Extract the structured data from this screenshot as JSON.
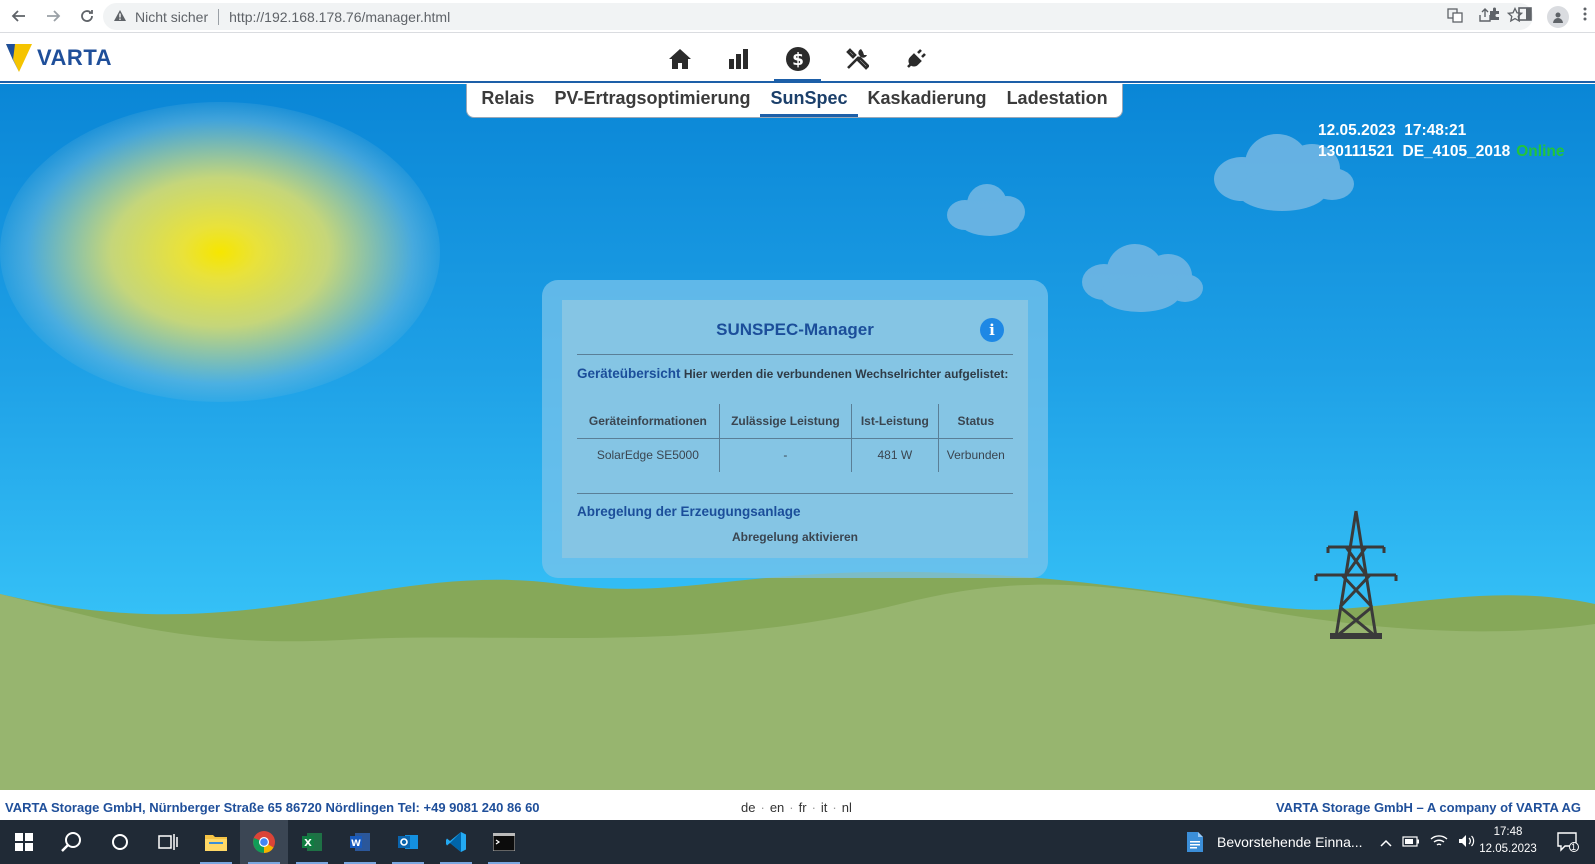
{
  "browser": {
    "security_label": "Nicht sicher",
    "url": "http://192.168.178.76/manager.html"
  },
  "app": {
    "logo_text": "VARTA",
    "top_nav": [
      {
        "icon": "home-icon"
      },
      {
        "icon": "bar-chart-icon"
      },
      {
        "icon": "dollar-icon",
        "active": true
      },
      {
        "icon": "tools-icon"
      },
      {
        "icon": "plug-icon"
      }
    ],
    "sub_nav": [
      "Relais",
      "PV-Ertragsoptimierung",
      "SunSpec",
      "Kaskadierung",
      "Ladestation"
    ],
    "sub_nav_active": "SunSpec"
  },
  "status": {
    "date": "12.05.2023",
    "time": "17:48:21",
    "serial": "130111521",
    "norm": "DE_4105_2018",
    "connection": "Online"
  },
  "panel": {
    "title": "SUNSPEC-Manager",
    "info_icon_glyph": "i",
    "overview_heading": "Geräteübersicht",
    "overview_text": "Hier werden die verbundenen Wechselrichter aufgelistet:",
    "table": {
      "headers": [
        "Geräteinformationen",
        "Zulässige Leistung",
        "Ist-Leistung",
        "Status"
      ],
      "rows": [
        [
          "SolarEdge SE5000",
          "-",
          "481 W",
          "Verbunden"
        ]
      ]
    },
    "curtail_heading": "Abregelung der Erzeugungsanlage",
    "curtail_action": "Abregelung aktivieren"
  },
  "footer": {
    "left": "VARTA Storage GmbH, Nürnberger Straße 65 86720 Nördlingen Tel: +49 9081 240 86 60",
    "languages": [
      "de",
      "en",
      "fr",
      "it",
      "nl"
    ],
    "right": "VARTA Storage GmbH – A company of VARTA AG"
  },
  "taskbar": {
    "notification_text": "Bevorstehende Einna...",
    "clock_time": "17:48",
    "clock_date": "12.05.2023",
    "action_badge": "1"
  },
  "colors": {
    "brand_blue": "#1f4f9a",
    "accent": "#1d5fa8",
    "online_green": "#22c53a",
    "sun_yellow": "#f6e600",
    "hill_green": "#93b26a"
  }
}
